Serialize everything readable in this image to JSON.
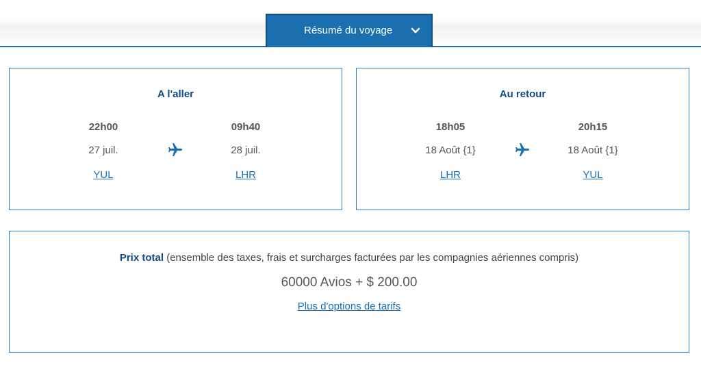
{
  "summary_tab": {
    "label": "Résumé du voyage",
    "icon": "chevron-down-icon"
  },
  "outbound": {
    "title": "A l'aller",
    "departure": {
      "time": "22h00",
      "date": "27 juil.",
      "airport": "YUL"
    },
    "arrival": {
      "time": "09h40",
      "date": "28 juil.",
      "airport": "LHR"
    },
    "icon": "plane-icon"
  },
  "return": {
    "title": "Au retour",
    "departure": {
      "time": "18h05",
      "date": "18 Août {1}",
      "airport": "LHR"
    },
    "arrival": {
      "time": "20h15",
      "date": "18 Août {1}",
      "airport": "YUL"
    },
    "icon": "plane-icon"
  },
  "price": {
    "label_strong": "Prix total",
    "label_rest": " (ensemble des taxes, frais et surcharges facturées par les compagnies aériennes compris)",
    "amount": "60000 Avios + $ 200.00",
    "more_options": "Plus d'options de tarifs"
  },
  "colors": {
    "accent": "#1a6fae",
    "title": "#0e4a86",
    "link": "#1a6fb5",
    "border": "#2a86c8"
  }
}
